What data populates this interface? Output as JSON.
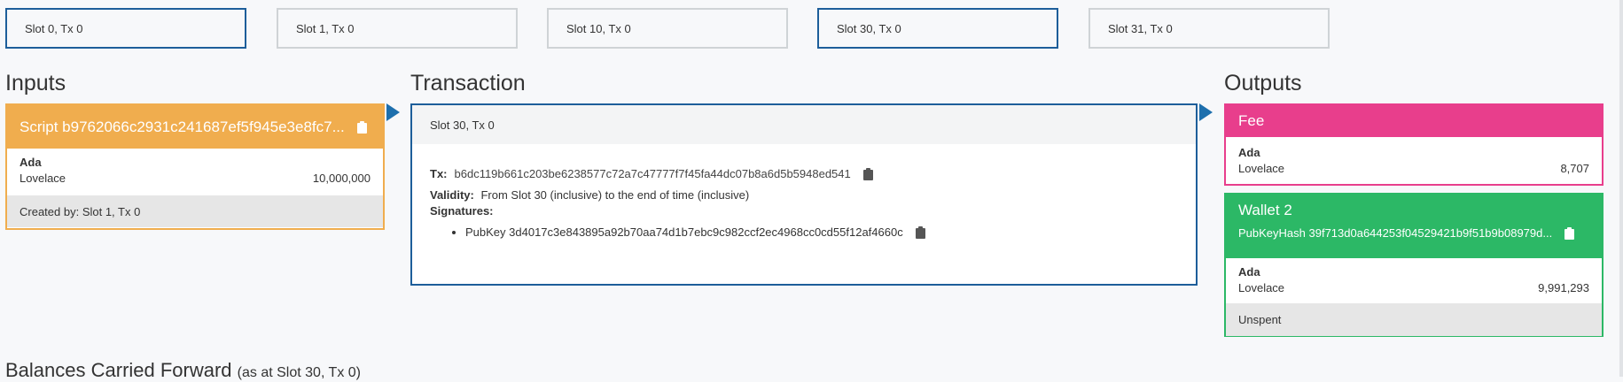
{
  "tx_selector": [
    {
      "label": "Slot 0, Tx 0",
      "active": true
    },
    {
      "label": "Slot 1, Tx 0",
      "active": false
    },
    {
      "label": "Slot 10, Tx 0",
      "active": false
    },
    {
      "label": "Slot 30, Tx 0",
      "active": true
    },
    {
      "label": "Slot 31, Tx 0",
      "active": false
    }
  ],
  "inputs": {
    "title": "Inputs",
    "card": {
      "header": "Script b9762066c2931c241687ef5f945e3e8fc7...",
      "color": "#f0ad4e",
      "ada_label": "Ada",
      "currency": "Lovelace",
      "amount": "10,000,000",
      "footer": "Created by: Slot 1, Tx 0"
    }
  },
  "transaction": {
    "title": "Transaction",
    "header": "Slot 30, Tx 0",
    "tx_label": "Tx:",
    "tx_hash": "b6dc119b661c203be6238577c72a7c47777f7f45fa44dc07b8a6d5b5948ed541",
    "validity_label": "Validity:",
    "validity_value": "From Slot 30 (inclusive) to the end of time (inclusive)",
    "signatures_label": "Signatures:",
    "signatures": [
      "PubKey 3d4017c3e843895a92b70aa74d1b7ebc9c982ccf2ec4968cc0cd55f12af4660c"
    ]
  },
  "outputs": {
    "title": "Outputs",
    "fee": {
      "header": "Fee",
      "color": "#e83e8c",
      "ada_label": "Ada",
      "currency": "Lovelace",
      "amount": "8,707"
    },
    "wallet": {
      "header": "Wallet 2",
      "subheader": "PubKeyHash 39f713d0a644253f04529421b9f51b9b08979d...",
      "color": "#2cb866",
      "ada_label": "Ada",
      "currency": "Lovelace",
      "amount": "9,991,293",
      "footer": "Unspent"
    }
  },
  "balances": {
    "title": "Balances Carried Forward",
    "subtitle": "(as at Slot 30, Tx 0)"
  },
  "icons": {
    "clipboard": "clipboard-icon",
    "arrow": "arrow-right-icon"
  }
}
